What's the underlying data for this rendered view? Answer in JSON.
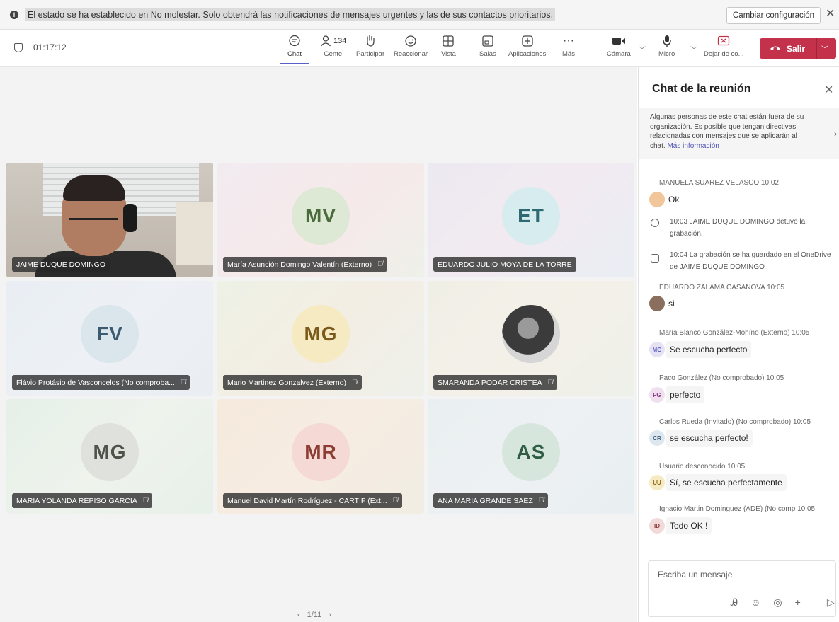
{
  "notification": {
    "message": "El estado se ha establecido en No molestar. Solo obtendrá las notificaciones de mensajes urgentes y las de sus contactos prioritarios.",
    "change_settings": "Cambiar configuración",
    "info_icon": "i",
    "close_icon": "✕"
  },
  "toolbar": {
    "timer": "01:17:12",
    "chat": "Chat",
    "people": "Gente",
    "people_count": "134",
    "raise": "Participar",
    "react": "Reaccionar",
    "view": "Vista",
    "rooms": "Salas",
    "apps": "Aplicaciones",
    "more": "Más",
    "camera": "Cámara",
    "mic": "Micro",
    "stop_sharing": "Dejar de co...",
    "leave": "Salir"
  },
  "tiles": [
    {
      "initials": "",
      "name": "JAIME DUQUE DOMINGO",
      "muted": false
    },
    {
      "initials": "MV",
      "name": "María Asunción Domingo Valentín (Externo)",
      "muted": true
    },
    {
      "initials": "ET",
      "name": "EDUARDO JULIO MOYA DE LA TORRE",
      "muted": false
    },
    {
      "initials": "FV",
      "name": "Flávio Protásio de Vasconcelos (No comproba...",
      "muted": true
    },
    {
      "initials": "MG",
      "name": "Mario Martinez Gonzalvez (Externo)",
      "muted": true
    },
    {
      "initials": "",
      "name": "SMARANDA PODAR CRISTEA",
      "muted": true
    },
    {
      "initials": "MG",
      "name": "MARIA YOLANDA REPISO GARCIA",
      "muted": true
    },
    {
      "initials": "MR",
      "name": "Manuel David Martín Rodríguez - CARTIF (Ext...",
      "muted": true
    },
    {
      "initials": "AS",
      "name": "ANA MARIA GRANDE SAEZ",
      "muted": true
    }
  ],
  "colors": {
    "mv": "#dde8d5",
    "et": "#d6ecef",
    "fv": "#dbe5ec",
    "mg1": "#f6eac2",
    "mg2": "#dfe1dd",
    "mr": "#f5d9d4",
    "as": "#d7e6dd",
    "accent": "#5b5fc7",
    "leave": "#c4314b"
  },
  "pager": {
    "prev": "‹",
    "page": "1/11",
    "next": "›"
  },
  "chat": {
    "title": "Chat de la reunión",
    "banner": "Algunas personas de este chat están fuera de su organización. Es posible que tengan directivas relacionadas con mensajes que se aplicarán al chat.",
    "banner_link": "Más información",
    "messages": [
      {
        "author": "MANUELA SUAREZ VELASCO  10:02",
        "text": "Ok",
        "initials": ""
      },
      {
        "author": "",
        "text": "10:03   JAIME DUQUE DOMINGO detuvo la grabación.",
        "initials": ""
      },
      {
        "author": "",
        "text": "10:04   La grabación se ha guardado en el OneDrive de JAIME DUQUE DOMINGO",
        "initials": ""
      },
      {
        "author": "EDUARDO ZALAMA CASANOVA  10:05",
        "text": "si",
        "initials": ""
      },
      {
        "author": "María Blanco González-Mohíno (Externo)  10:05",
        "text": "Se escucha perfecto",
        "initials": "MG"
      },
      {
        "author": "Paco González (No comprobado)  10:05",
        "text": "perfecto",
        "initials": "PG"
      },
      {
        "author": "Carlos Rueda (Invitado) (No comprobado)  10:05",
        "text": "se escucha perfecto!",
        "initials": "CR"
      },
      {
        "author": "Usuario desconocido  10:05",
        "text": "Sí, se escucha perfectamente",
        "initials": "UU"
      },
      {
        "author": "Ignacio Martin Dominguez (ADE) (No comp  10:05",
        "text": "Todo OK !",
        "initials": "ID"
      }
    ],
    "compose_placeholder": "Escriba un mensaje"
  }
}
